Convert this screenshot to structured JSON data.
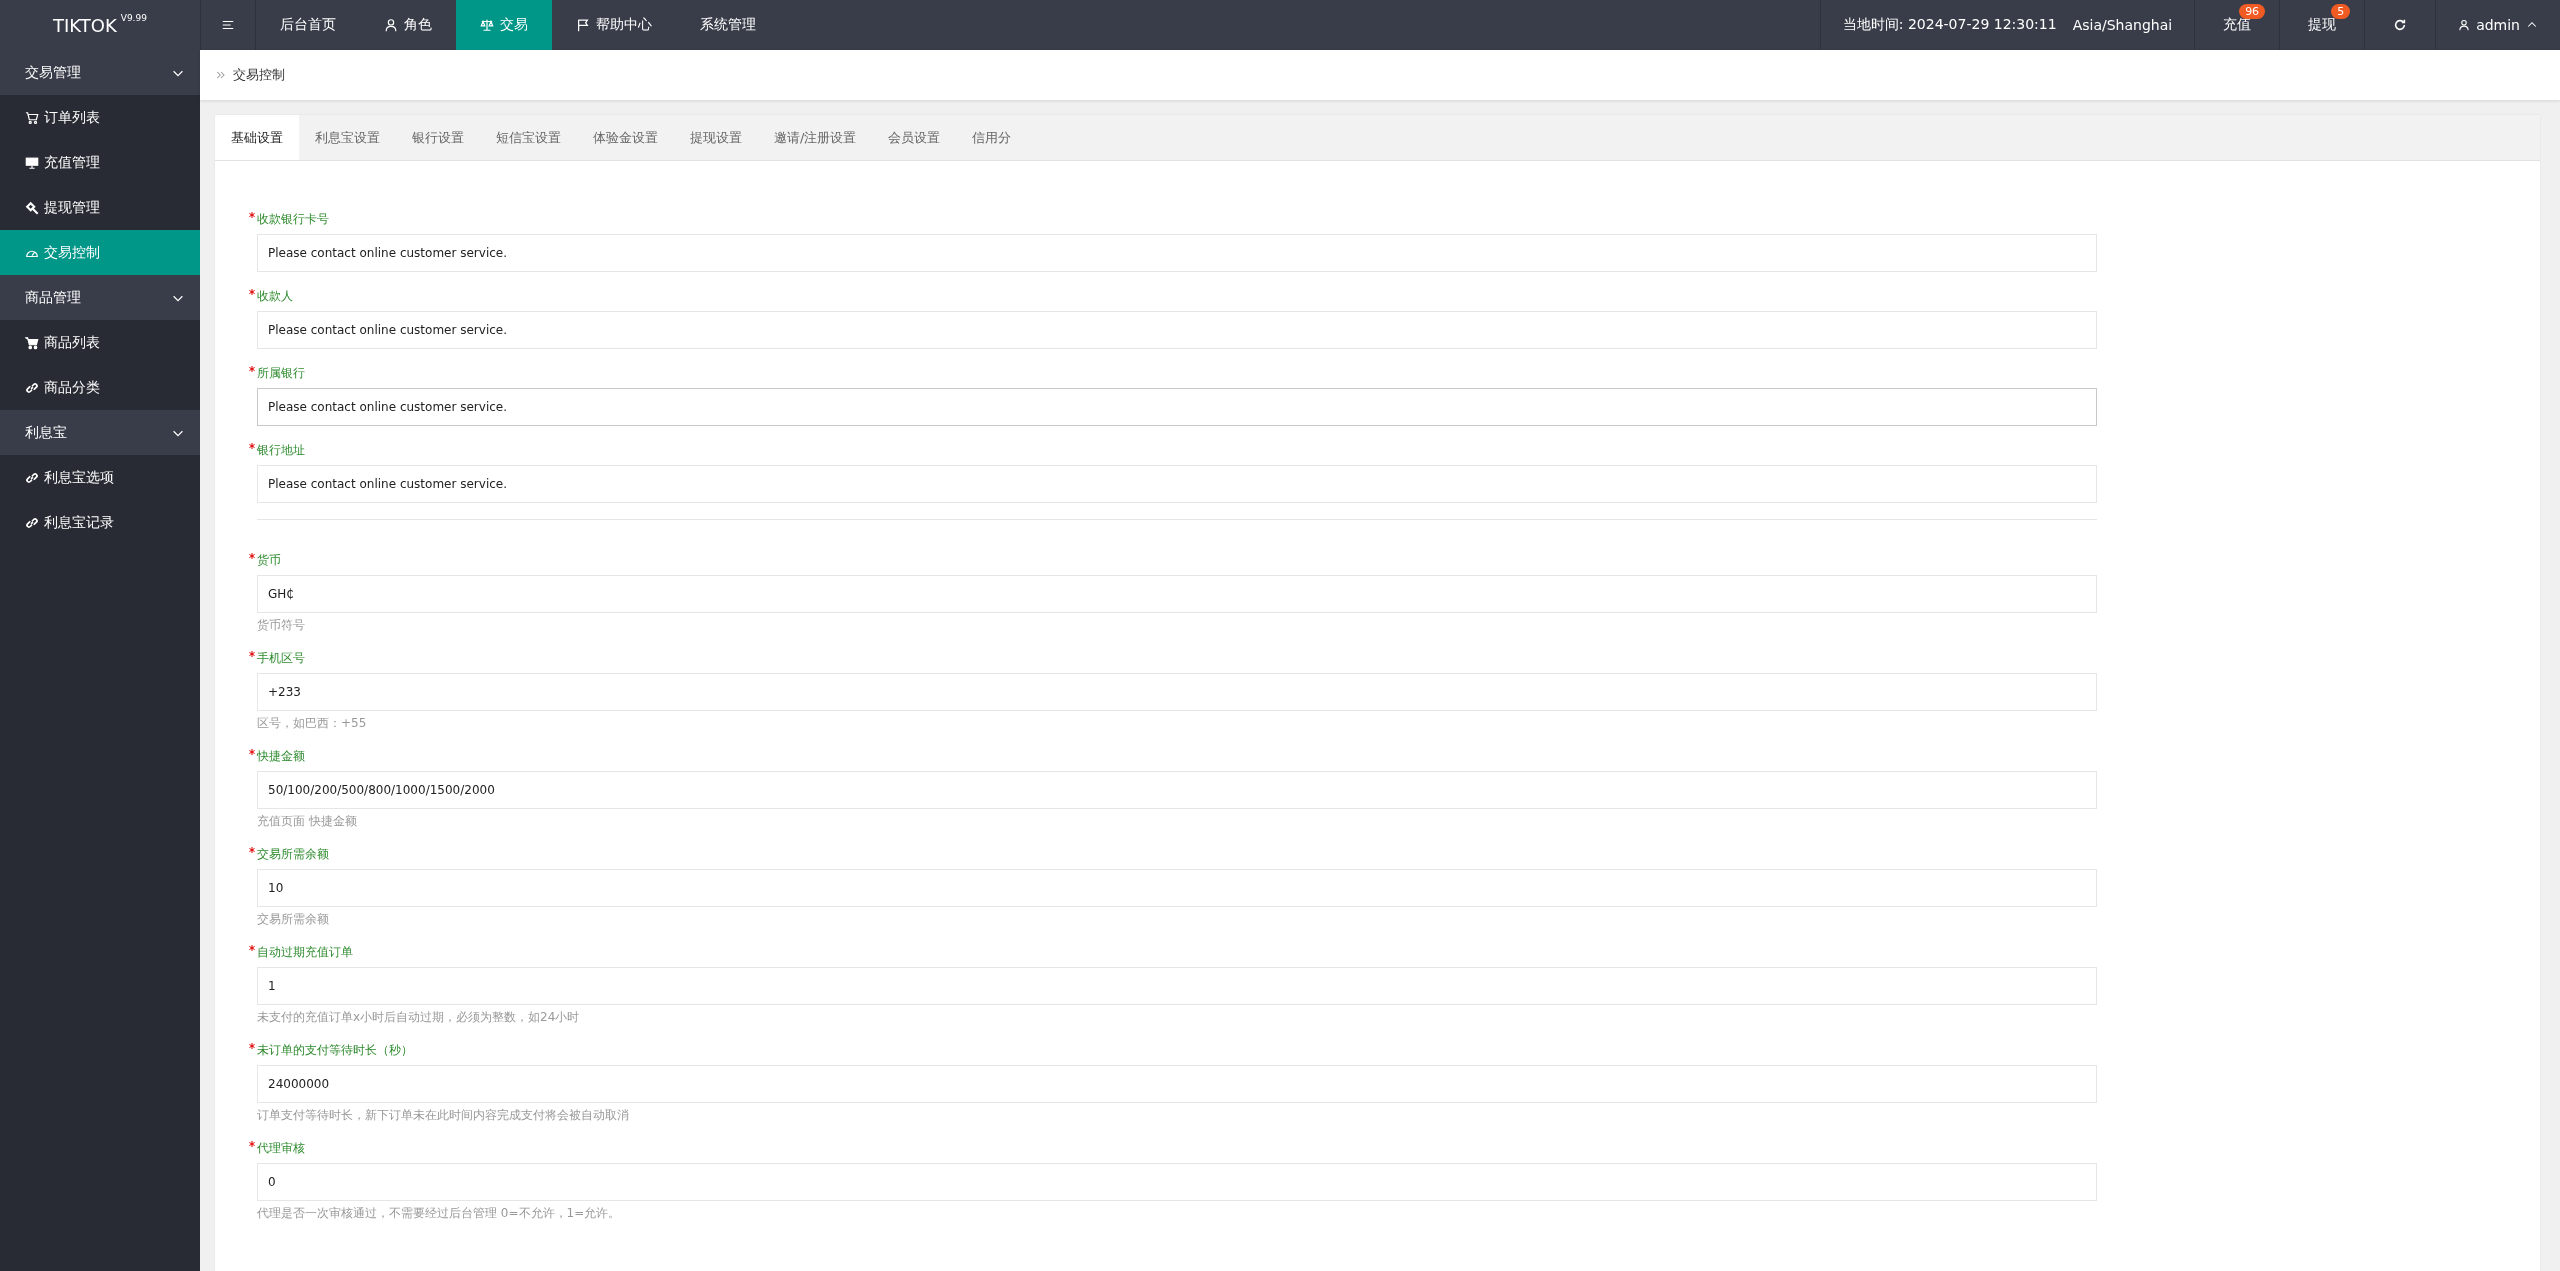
{
  "brand": {
    "name": "TIKTOK",
    "version": "V9.99"
  },
  "top_nav": [
    {
      "label": "后台首页",
      "selected": false
    },
    {
      "label": "角色",
      "selected": false
    },
    {
      "label": "交易",
      "selected": true
    },
    {
      "label": "帮助中心",
      "selected": false
    },
    {
      "label": "系统管理",
      "selected": false
    }
  ],
  "header_right": {
    "local_time": "当地时间: 2024-07-29 12:30:11",
    "timezone": "Asia/Shanghai",
    "actions": [
      {
        "label": "充值",
        "badge": "96"
      },
      {
        "label": "提现",
        "badge": "5"
      }
    ],
    "user": "admin"
  },
  "sidebar": [
    {
      "label": "交易管理",
      "expanded": true,
      "children": [
        {
          "label": "订单列表",
          "selected": false
        },
        {
          "label": "充值管理",
          "selected": false
        },
        {
          "label": "提现管理",
          "selected": false
        },
        {
          "label": "交易控制",
          "selected": true
        }
      ]
    },
    {
      "label": "商品管理",
      "expanded": true,
      "children": [
        {
          "label": "商品列表",
          "selected": false
        },
        {
          "label": "商品分类",
          "selected": false
        }
      ]
    },
    {
      "label": "利息宝",
      "expanded": true,
      "children": [
        {
          "label": "利息宝选项",
          "selected": false
        },
        {
          "label": "利息宝记录",
          "selected": false
        }
      ]
    }
  ],
  "breadcrumb": "交易控制",
  "tabs": [
    {
      "label": "基础设置",
      "selected": true
    },
    {
      "label": "利息宝设置",
      "selected": false
    },
    {
      "label": "银行设置",
      "selected": false
    },
    {
      "label": "短信宝设置",
      "selected": false
    },
    {
      "label": "体验金设置",
      "selected": false
    },
    {
      "label": "提现设置",
      "selected": false
    },
    {
      "label": "邀请/注册设置",
      "selected": false
    },
    {
      "label": "会员设置",
      "selected": false
    },
    {
      "label": "信用分",
      "selected": false
    }
  ],
  "form": {
    "groups": [
      {
        "fields": [
          {
            "label": "收款银行卡号",
            "required": true,
            "value": "Please contact online customer service.",
            "focused": false
          },
          {
            "label": "收款人",
            "required": true,
            "value": "Please contact online customer service.",
            "focused": false
          },
          {
            "label": "所属银行",
            "required": true,
            "value": "Please contact online customer service.",
            "focused": true
          },
          {
            "label": "银行地址",
            "required": true,
            "value": "Please contact online customer service.",
            "focused": false
          }
        ]
      },
      {
        "fields": [
          {
            "label": "货币",
            "required": true,
            "value": "GH₵",
            "help": "货币符号",
            "focused": false
          },
          {
            "label": "手机区号",
            "required": true,
            "value": "+233",
            "help": "区号，如巴西：+55",
            "focused": false
          },
          {
            "label": "快捷金额",
            "required": true,
            "value": "50/100/200/500/800/1000/1500/2000",
            "help": "充值页面 快捷金额",
            "focused": false
          },
          {
            "label": "交易所需余额",
            "required": true,
            "value": "10",
            "help": "交易所需余额",
            "focused": false
          },
          {
            "label": "自动过期充值订单",
            "required": true,
            "value": "1",
            "help": "未支付的充值订单x小时后自动过期，必须为整数，如24小时",
            "focused": false
          },
          {
            "label": "未订单的支付等待时长（秒）",
            "required": true,
            "value": "24000000",
            "help": "订单支付等待时长，新下订单未在此时间内容完成支付将会被自动取消",
            "focused": false
          },
          {
            "label": "代理审核",
            "required": true,
            "value": "0",
            "help": "代理是否一次审核通过，不需要经过后台管理 0=不允许，1=允许。",
            "focused": false
          }
        ]
      }
    ]
  }
}
